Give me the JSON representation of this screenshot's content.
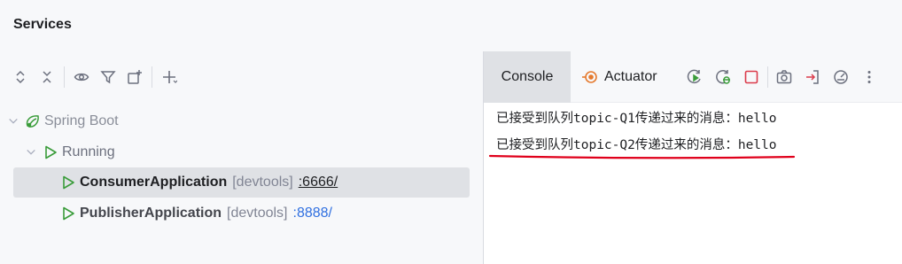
{
  "window": {
    "title": "Services"
  },
  "tree": {
    "group": "Spring Boot",
    "status": "Running",
    "apps": [
      {
        "name": "ConsumerApplication",
        "tag": "[devtools]",
        "port": ":6666/"
      },
      {
        "name": "PublisherApplication",
        "tag": "[devtools]",
        "port": ":8888/"
      }
    ]
  },
  "tabs": {
    "console": "Console",
    "actuator": "Actuator"
  },
  "console": {
    "lines": [
      "已接受到队列topic-Q1传递过来的消息：hello",
      "已接受到队列topic-Q2传递过来的消息：hello"
    ]
  },
  "colors": {
    "run_green": "#3a9c3a",
    "stop_red": "#db3b4b",
    "actuator_orange": "#e57a2e",
    "link_blue": "#2f6fe0",
    "highlight_red": "#e0001b"
  },
  "icons": {
    "left_toolbar": [
      "expand-all-icon",
      "collapse-all-icon",
      "eye-icon",
      "filter-icon",
      "new-tab-icon",
      "add-icon"
    ],
    "right_toolbar": [
      "rerun-icon",
      "debug-rerun-icon",
      "stop-icon",
      "camera-icon",
      "login-icon",
      "gauge-icon",
      "more-icon"
    ]
  }
}
